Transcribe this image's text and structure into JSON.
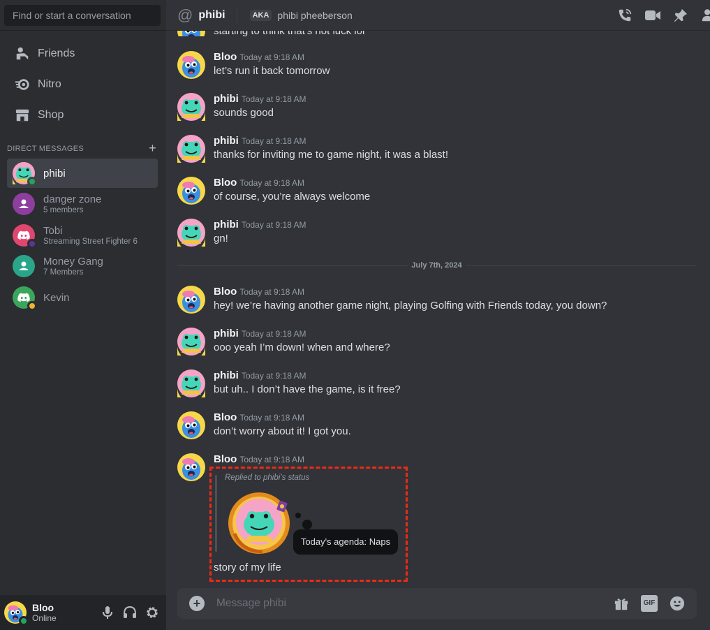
{
  "sidebar": {
    "search_placeholder": "Find or start a conversation",
    "nav": [
      {
        "label": "Friends"
      },
      {
        "label": "Nitro"
      },
      {
        "label": "Shop"
      }
    ],
    "dm_header": "DIRECT MESSAGES",
    "dm_add": "+",
    "dms": [
      {
        "name": "phibi",
        "sub": ""
      },
      {
        "name": "danger zone",
        "sub": "5 members"
      },
      {
        "name": "Tobi",
        "sub": "Streaming Street Fighter 6"
      },
      {
        "name": "Money Gang",
        "sub": "7 Members"
      },
      {
        "name": "Kevin",
        "sub": ""
      }
    ],
    "user": {
      "name": "Bloo",
      "status": "Online"
    }
  },
  "header": {
    "at": "@",
    "name": "phibi",
    "aka_badge": "AKA",
    "aka_name": "phibi pheeberson"
  },
  "messages": {
    "partial_text": "starting to think that's not luck lol",
    "items": [
      {
        "author": "Bloo",
        "time": "Today at 9:18 AM",
        "text": "let’s run it back tomorrow"
      },
      {
        "author": "phibi",
        "time": "Today at 9:18 AM",
        "text": "sounds good"
      },
      {
        "author": "phibi",
        "time": "Today at 9:18 AM",
        "text": "thanks for inviting me to game night, it was a blast!"
      },
      {
        "author": "Bloo",
        "time": "Today at 9:18 AM",
        "text": "of course, you’re always welcome"
      },
      {
        "author": "phibi",
        "time": "Today at 9:18 AM",
        "text": "gn!"
      },
      {
        "author": "Bloo",
        "time": "Today at 9:18 AM",
        "text": "hey! we’re having another game night, playing Golfing with Friends today, you down?"
      },
      {
        "author": "phibi",
        "time": "Today at 9:18 AM",
        "text": "ooo yeah I’m down! when and where?"
      },
      {
        "author": "phibi",
        "time": "Today at 9:18 AM",
        "text": "but uh.. I don’t have the game, is it free?"
      },
      {
        "author": "Bloo",
        "time": "Today at 9:18 AM",
        "text": "don’t worry about it! I got you."
      },
      {
        "author": "Bloo",
        "time": "Today at 9:18 AM",
        "text": ""
      }
    ],
    "date_divider": "July 7th, 2024",
    "reply": {
      "replied_label": "Replied to phibi’s status",
      "status_text": "Today's agenda: Naps",
      "message": "story of my life"
    }
  },
  "composer": {
    "placeholder": "Message phibi",
    "gif_label": "GIF"
  },
  "colors": {
    "online": "#23a55a",
    "idle": "#f0b232",
    "streaming": "#593695",
    "highlight": "#ee2a14",
    "brand": "#5865f2"
  }
}
